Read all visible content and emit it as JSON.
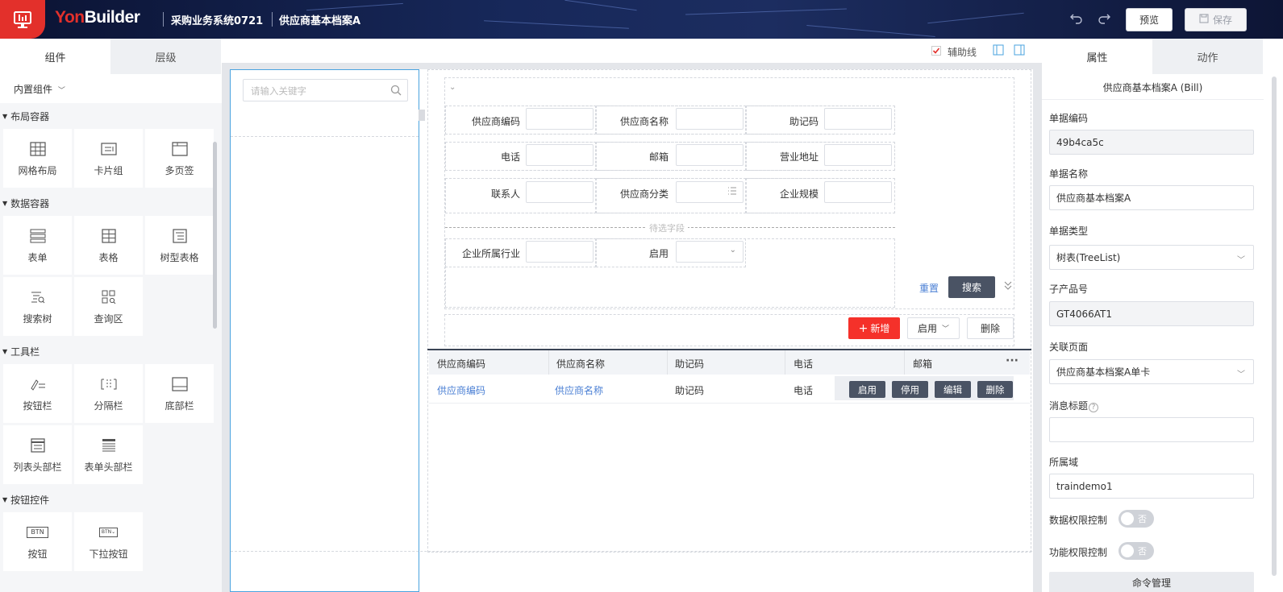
{
  "header": {
    "brand_yon": "Yon",
    "brand_builder": "Builder",
    "app_name": "采购业务系统0721",
    "page_name": "供应商基本档案A",
    "undo_icon": "undo-icon",
    "redo_icon": "redo-icon",
    "preview_label": "预览",
    "save_label": "保存"
  },
  "left_panel": {
    "tabs": [
      "组件",
      "层级"
    ],
    "library_select": "内置组件",
    "sections": [
      {
        "title": "布局容器",
        "items": [
          {
            "label": "网格布局",
            "icon": "grid-layout-icon"
          },
          {
            "label": "卡片组",
            "icon": "card-group-icon"
          },
          {
            "label": "多页签",
            "icon": "multi-tab-icon"
          }
        ]
      },
      {
        "title": "数据容器",
        "items": [
          {
            "label": "表单",
            "icon": "form-icon"
          },
          {
            "label": "表格",
            "icon": "table-icon"
          },
          {
            "label": "树型表格",
            "icon": "tree-table-icon"
          },
          {
            "label": "搜索树",
            "icon": "search-tree-icon"
          },
          {
            "label": "查询区",
            "icon": "query-area-icon"
          }
        ]
      },
      {
        "title": "工具栏",
        "items": [
          {
            "label": "按钮栏",
            "icon": "button-bar-icon"
          },
          {
            "label": "分隔栏",
            "icon": "divider-bar-icon"
          },
          {
            "label": "底部栏",
            "icon": "bottom-bar-icon"
          },
          {
            "label": "列表头部栏",
            "icon": "list-header-icon"
          },
          {
            "label": "表单头部栏",
            "icon": "form-header-icon"
          }
        ]
      },
      {
        "title": "按钮控件",
        "items": [
          {
            "label": "按钮",
            "icon": "btn-icon"
          },
          {
            "label": "下拉按钮",
            "icon": "dropdown-btn-icon"
          }
        ]
      }
    ],
    "btn_icon_text": "BTN"
  },
  "canvas_toolbar": {
    "guideline_label": "辅助线",
    "guideline_checked": true
  },
  "canvas": {
    "tree_search_placeholder": "请输入关键字",
    "query_fields": [
      [
        "供应商编码",
        "供应商名称",
        "助记码"
      ],
      [
        "电话",
        "邮箱",
        "营业地址"
      ],
      [
        "联系人",
        "供应商分类",
        "企业规模"
      ]
    ],
    "pending_label": "待选字段",
    "extra_fields": [
      "企业所属行业",
      "启用"
    ],
    "reset_label": "重置",
    "search_label": "搜索",
    "new_label": "新增",
    "enable_dropdown_label": "启用",
    "delete_label": "删除",
    "table_headers": [
      "供应商编码",
      "供应商名称",
      "助记码",
      "电话",
      "邮箱"
    ],
    "table_row": [
      "供应商编码",
      "供应商名称",
      "助记码",
      "电话"
    ],
    "row_actions": [
      "启用",
      "停用",
      "编辑",
      "删除"
    ],
    "more_icon": "more-icon"
  },
  "right_panel": {
    "tabs": [
      "属性",
      "动作"
    ],
    "title": "供应商基本档案A (Bill)",
    "fields": [
      {
        "label": "单据编码",
        "value": "49b4ca5c",
        "readonly": true
      },
      {
        "label": "单据名称",
        "value": "供应商基本档案A",
        "readonly": false
      },
      {
        "label": "单据类型",
        "value": "树表(TreeList)",
        "readonly": false,
        "select": true
      },
      {
        "label": "子产品号",
        "value": "GT4066AT1",
        "readonly": true
      },
      {
        "label": "关联页面",
        "value": "供应商基本档案A单卡",
        "readonly": false,
        "select": true
      },
      {
        "label": "消息标题",
        "value": "",
        "readonly": false,
        "help": true
      },
      {
        "label": "所属域",
        "value": "traindemo1",
        "readonly": false
      }
    ],
    "toggles": [
      {
        "label": "数据权限控制",
        "value": "否"
      },
      {
        "label": "功能权限控制",
        "value": "否"
      }
    ],
    "bottom_button": "命令管理"
  },
  "colors": {
    "header_bg": "#17285a",
    "brand_red": "#e3302b",
    "new_button": "#f5312a",
    "search_button": "#4a5364",
    "link_blue": "#4a7fd4",
    "selection_blue": "#4aa3df"
  }
}
